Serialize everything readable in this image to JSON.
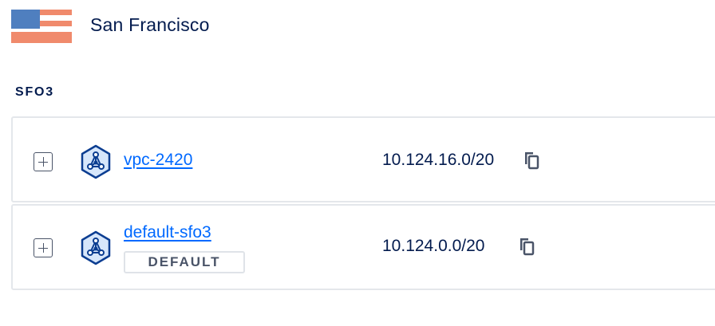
{
  "region": {
    "name": "San Francisco",
    "flag_icon": "us-flag-icon",
    "flag_colors": {
      "canton": "#4f7fbf",
      "stripe": "#f08a6c"
    }
  },
  "datacenter": {
    "label": "SFO3"
  },
  "vpcs": [
    {
      "name": "vpc-2420",
      "ip_range": "10.124.16.0/20",
      "is_default": false,
      "icon": "vpc-network-icon"
    },
    {
      "name": "default-sfo3",
      "ip_range": "10.124.0.0/20",
      "is_default": true,
      "default_badge": "DEFAULT",
      "icon": "vpc-network-icon"
    }
  ],
  "colors": {
    "link": "#0069ff",
    "text": "#031b4e",
    "border": "#e4e7eb",
    "icon_stroke": "#0b3d91",
    "icon_fill": "#d6e6fb"
  }
}
